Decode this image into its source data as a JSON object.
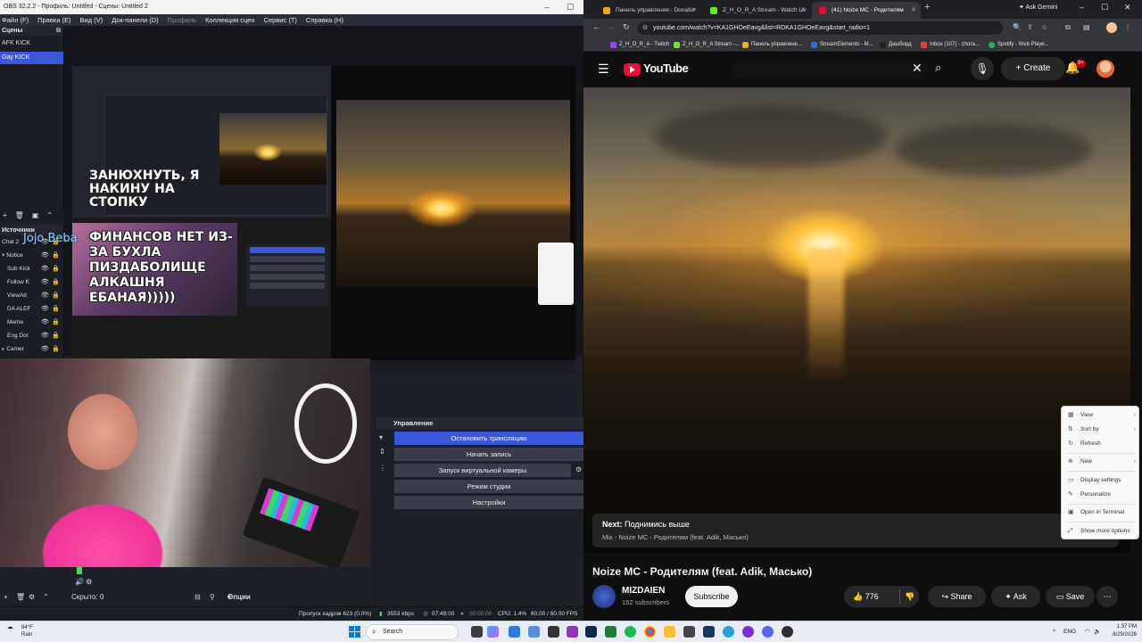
{
  "obs": {
    "title": "OBS 32.2.2 - Профиль: Untitled - Сцены: Untitled 2",
    "menu": [
      "Файл (F)",
      "Правка (E)",
      "Вид (V)",
      "Док-панели (D)",
      "Профиль",
      "Коллекция сцен",
      "Сервис (T)",
      "Справка (H)"
    ],
    "scenes_header": "Сцены",
    "scenes": [
      "AFK KICK",
      "Gay KICK"
    ],
    "sources_header": "Источники",
    "sources": [
      "Chat 2",
      "Notice",
      "Sub Kick",
      "Follow K",
      "ViewAtt",
      "DA ALEF",
      "Meme",
      "Eng Dor",
      "Camer"
    ],
    "overlay_text_1": "ЗАНЮХНУТЬ, Я НАКИНУ НА СТОПКУ",
    "overlay_text_2": "ФИНАНСОВ НЕТ ИЗ-ЗА БУХЛА ПИЗДАБОЛИЩЕ АЛКАШНЯ ЕБАНАЯ)))))",
    "overlay_name": "Jojo Beba",
    "controls_header": "Управление",
    "controls": {
      "stop_stream": "Остановить трансляцию",
      "start_record": "Начать запись",
      "virtual_cam": "Запуск виртуальной камеры",
      "studio_mode": "Режим студии",
      "settings": "Настройки"
    },
    "hidden_label": "Скрыто: 0",
    "options_label": "Опции",
    "status": {
      "dropped": "Пропуск кадров 623 (0.0%)",
      "bitrate": "3553 kbps",
      "stream_time": "07:49:00",
      "rec_time": "00:00:00",
      "cpu": "CPU: 1.4%",
      "fps": "60.00 / 60.00 FPS"
    }
  },
  "chrome": {
    "tabs": [
      {
        "label": "Панель управления - Donatio",
        "color": "#f5a623"
      },
      {
        "label": "Z_H_O_R_A Stream - Watch Liv",
        "color": "#53fc18"
      },
      {
        "label": "(41) Noize MC - Родителям",
        "color": "#ff0033"
      }
    ],
    "ask_gemini": "Ask Gemini",
    "url": "youtube.com/watch?v=KA1GHOeEavg&list=RDKA1GHOeEavg&start_radio=1",
    "bookmarks": [
      {
        "label": "Z_H_O_R_A - Twitch",
        "color": "#9146ff"
      },
      {
        "label": "Z_H_O_R_A Stream -...",
        "color": "#53fc18"
      },
      {
        "label": "Панель управлени...",
        "color": "#f5a623"
      },
      {
        "label": "StreamElements - M...",
        "color": "#2b6be6"
      },
      {
        "label": "Дашборд",
        "color": "#222222"
      },
      {
        "label": "Inbox (107) - zhora...",
        "color": "#ea4335"
      },
      {
        "label": "Spotify - Web Playe...",
        "color": "#1db954"
      }
    ]
  },
  "youtube": {
    "logo": "YouTube",
    "create": "Create",
    "notif_badge": "9+",
    "next_label": "Next:",
    "next_title": "Поднимись выше",
    "next_sub": "Mix - Noize MC - Родителям (feat. Adik, Масько)",
    "video_title": "Noize MC - Родителям (feat. Adik, Масько)",
    "channel": "MIZDAIEN",
    "subscribers": "152 subscribers",
    "subscribe": "Subscribe",
    "likes": "776",
    "share": "Share",
    "ask": "Ask",
    "save": "Save"
  },
  "context_menu": {
    "items": [
      "View",
      "Sort by",
      "Refresh",
      "New",
      "Display settings",
      "Personalize",
      "Open in Terminal",
      "Show more options"
    ]
  },
  "taskbar": {
    "weather_temp": "84°F",
    "weather_desc": "Rain",
    "search": "Search",
    "lang": "ENG",
    "time": "1:37 PM",
    "date": "8/29/2026"
  }
}
